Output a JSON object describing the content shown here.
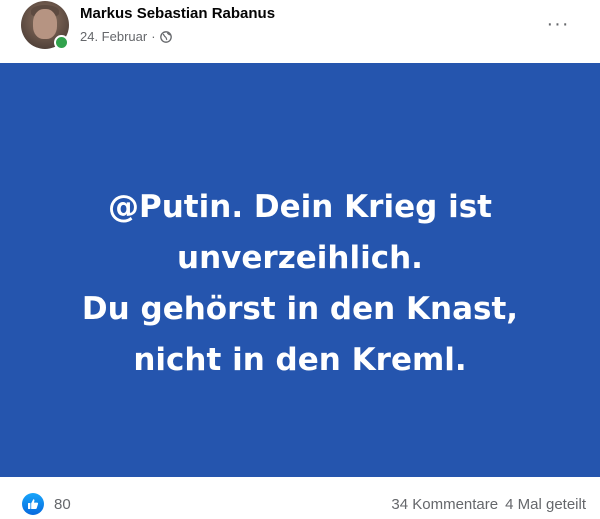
{
  "post": {
    "author": "Markus Sebastian Rabanus",
    "date": "24. Februar",
    "separator": "·",
    "audience_icon": "globe-icon",
    "more_icon": "ellipsis-icon",
    "more_label": "···",
    "author_online": true
  },
  "image": {
    "background_color": "#2555ae",
    "text_color": "#ffffff",
    "lines": [
      "@Putin. Dein Krieg ist",
      "unverzeihlich.",
      "Du gehörst in den Knast,",
      "nicht in den Kreml."
    ]
  },
  "footer": {
    "reaction_icon": "like-icon",
    "reaction_count": "80",
    "comments": "34 Kommentare",
    "shares": "4 Mal geteilt"
  },
  "colors": {
    "online": "#31a24c",
    "like": "#1877f2",
    "secondary_text": "#65676b"
  }
}
